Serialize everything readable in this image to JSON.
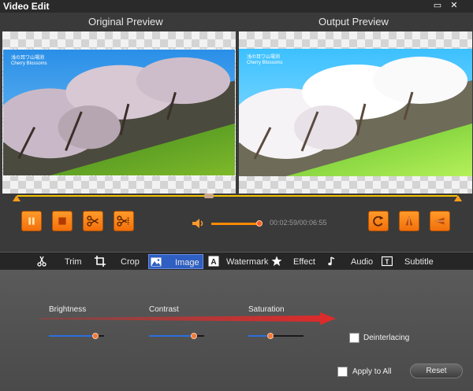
{
  "window": {
    "title": "Video Edit",
    "maximize_glyph": "▭",
    "close_glyph": "✕"
  },
  "preview": {
    "original_label": "Original Preview",
    "output_label": "Output Preview",
    "watermark_line1": "浅の耳ワ山場渕",
    "watermark_line2": "Cherry Blossoms"
  },
  "playback": {
    "time_current": "00:02:59",
    "time_total": "00:06:55",
    "time_text": "00:02:59/00:06:55",
    "volume_level": 0.92,
    "position": 0.44
  },
  "tabs": [
    {
      "label": "Trim",
      "icon": "scissors-icon"
    },
    {
      "label": "Crop",
      "icon": "crop-icon"
    },
    {
      "label": "Image",
      "icon": "image-icon",
      "active": true
    },
    {
      "label": "Watermark",
      "icon": "watermark-icon"
    },
    {
      "label": "Effect",
      "icon": "star-icon"
    },
    {
      "label": "Audio",
      "icon": "music-note-icon"
    },
    {
      "label": "Subtitle",
      "icon": "subtitle-icon"
    }
  ],
  "image_panel": {
    "brightness_label": "Brightness",
    "contrast_label": "Contrast",
    "saturation_label": "Saturation",
    "brightness_level": 0.85,
    "contrast_level": 0.82,
    "saturation_level": 0.4,
    "deinterlacing_label": "Deinterlacing",
    "apply_all_label": "Apply to All",
    "reset_label": "Reset"
  },
  "colors": {
    "accent_orange": "#f2700c",
    "active_tab": "#2f5fc2",
    "arrow_red": "#e02a2a",
    "timeline_yellow": "#f5c400"
  }
}
